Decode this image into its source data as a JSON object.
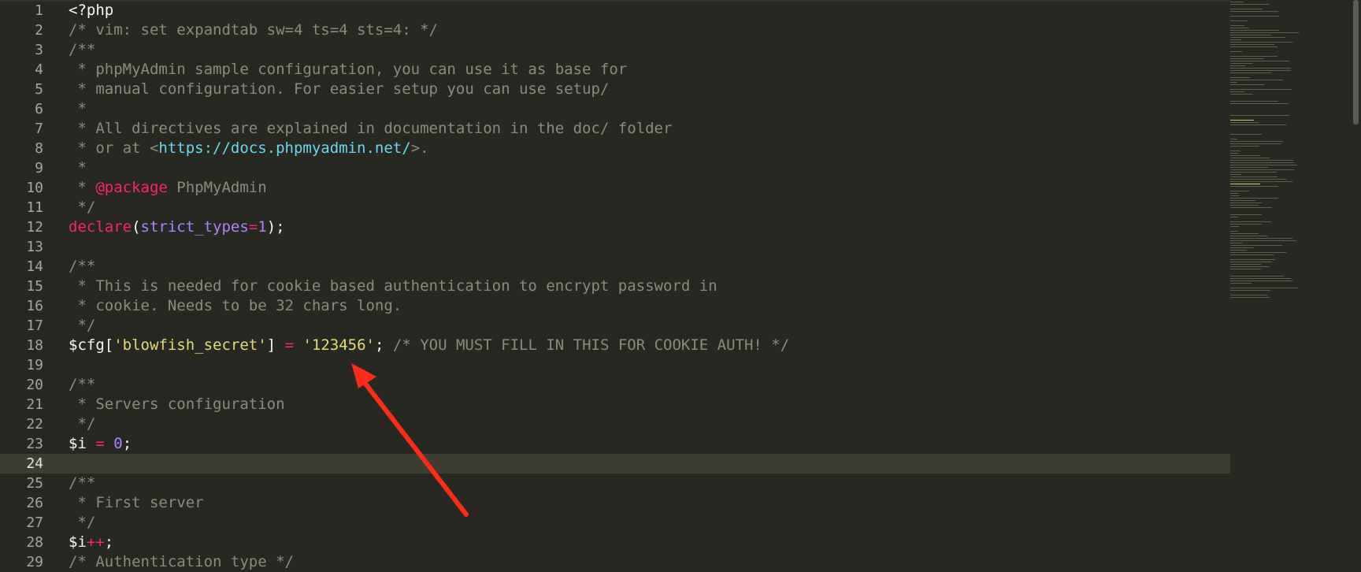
{
  "editor": {
    "language": "php",
    "theme_colors": {
      "background": "#272822",
      "comment": "#8e8b7a",
      "keyword": "#f92672",
      "number": "#ae81ff",
      "string": "#e6db74",
      "url": "#66d9ef",
      "text": "#f8f8f2"
    },
    "active_line": 24,
    "lines": [
      {
        "n": "1",
        "segs": [
          {
            "t": "<?php",
            "c": ""
          }
        ]
      },
      {
        "n": "2",
        "segs": [
          {
            "t": "/* vim: set expandtab sw=4 ts=4 sts=4: */",
            "c": "c"
          }
        ]
      },
      {
        "n": "3",
        "segs": [
          {
            "t": "/**",
            "c": "c"
          }
        ]
      },
      {
        "n": "4",
        "segs": [
          {
            "t": " * phpMyAdmin sample configuration, you can use it as base for",
            "c": "c"
          }
        ]
      },
      {
        "n": "5",
        "segs": [
          {
            "t": " * manual configuration. For easier setup you can use setup/",
            "c": "c"
          }
        ]
      },
      {
        "n": "6",
        "segs": [
          {
            "t": " *",
            "c": "c"
          }
        ]
      },
      {
        "n": "7",
        "segs": [
          {
            "t": " * All directives are explained in documentation in the doc/ folder",
            "c": "c"
          }
        ]
      },
      {
        "n": "8",
        "segs": [
          {
            "t": " * or at <",
            "c": "c"
          },
          {
            "t": "https://docs.phpmyadmin.net/",
            "c": "u"
          },
          {
            "t": ">.",
            "c": "c"
          }
        ]
      },
      {
        "n": "9",
        "segs": [
          {
            "t": " *",
            "c": "c"
          }
        ]
      },
      {
        "n": "10",
        "segs": [
          {
            "t": " * ",
            "c": "c"
          },
          {
            "t": "@package",
            "c": "k"
          },
          {
            "t": " PhpMyAdmin",
            "c": "c"
          }
        ]
      },
      {
        "n": "11",
        "segs": [
          {
            "t": " */",
            "c": "c"
          }
        ]
      },
      {
        "n": "12",
        "segs": [
          {
            "t": "declare",
            "c": "k"
          },
          {
            "t": "(",
            "c": ""
          },
          {
            "t": "strict_types",
            "c": "f"
          },
          {
            "t": "=",
            "c": "k"
          },
          {
            "t": "1",
            "c": "f"
          },
          {
            "t": ");",
            "c": ""
          }
        ]
      },
      {
        "n": "13",
        "segs": []
      },
      {
        "n": "14",
        "segs": [
          {
            "t": "/**",
            "c": "c"
          }
        ]
      },
      {
        "n": "15",
        "segs": [
          {
            "t": " * This is needed for cookie based authentication to encrypt password in",
            "c": "c"
          }
        ]
      },
      {
        "n": "16",
        "segs": [
          {
            "t": " * cookie. Needs to be 32 chars long.",
            "c": "c"
          }
        ]
      },
      {
        "n": "17",
        "segs": [
          {
            "t": " */",
            "c": "c"
          }
        ]
      },
      {
        "n": "18",
        "segs": [
          {
            "t": "$cfg[",
            "c": ""
          },
          {
            "t": "'blowfish_secret'",
            "c": "s"
          },
          {
            "t": "] ",
            "c": ""
          },
          {
            "t": "=",
            "c": "k"
          },
          {
            "t": " ",
            "c": ""
          },
          {
            "t": "'123456'",
            "c": "s"
          },
          {
            "t": "; ",
            "c": ""
          },
          {
            "t": "/* YOU MUST FILL IN THIS FOR COOKIE AUTH! */",
            "c": "c"
          }
        ]
      },
      {
        "n": "19",
        "segs": []
      },
      {
        "n": "20",
        "segs": [
          {
            "t": "/**",
            "c": "c"
          }
        ]
      },
      {
        "n": "21",
        "segs": [
          {
            "t": " * Servers configuration",
            "c": "c"
          }
        ]
      },
      {
        "n": "22",
        "segs": [
          {
            "t": " */",
            "c": "c"
          }
        ]
      },
      {
        "n": "23",
        "segs": [
          {
            "t": "$i ",
            "c": ""
          },
          {
            "t": "=",
            "c": "k"
          },
          {
            "t": " ",
            "c": ""
          },
          {
            "t": "0",
            "c": "f"
          },
          {
            "t": ";",
            "c": ""
          }
        ]
      },
      {
        "n": "24",
        "segs": []
      },
      {
        "n": "25",
        "segs": [
          {
            "t": "/**",
            "c": "c"
          }
        ]
      },
      {
        "n": "26",
        "segs": [
          {
            "t": " * First server",
            "c": "c"
          }
        ]
      },
      {
        "n": "27",
        "segs": [
          {
            "t": " */",
            "c": "c"
          }
        ]
      },
      {
        "n": "28",
        "segs": [
          {
            "t": "$i",
            "c": ""
          },
          {
            "t": "++",
            "c": "k"
          },
          {
            "t": ";",
            "c": ""
          }
        ]
      },
      {
        "n": "29",
        "segs": [
          {
            "t": "/* Authentication type */",
            "c": "c"
          }
        ]
      }
    ]
  },
  "annotation": {
    "type": "arrow",
    "color": "#ff2a1a",
    "points_to": "'123456'"
  }
}
